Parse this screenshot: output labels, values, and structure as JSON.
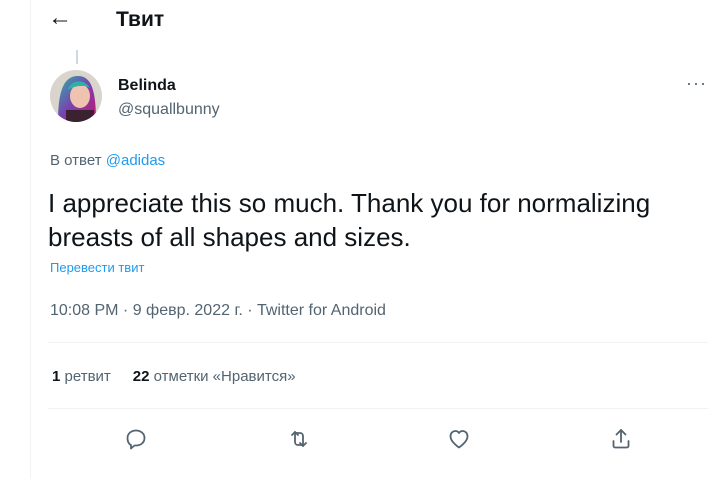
{
  "header": {
    "back_icon": "arrow-left-icon",
    "title": "Твит"
  },
  "tweet": {
    "author_name": "Belinda",
    "author_handle": "@squallbunny",
    "more_icon": "ellipsis-icon",
    "more_glyph": "···",
    "reply_prefix": "В ответ",
    "reply_to": "@adidas",
    "text": "I appreciate this so much. Thank you for normalizing breasts of all shapes and sizes.",
    "translate_label": "Перевести твит",
    "time": "10:08 PM",
    "date": "9 февр. 2022 г.",
    "source": "Twitter for Android",
    "separator": " · "
  },
  "stats": {
    "retweets_count": "1",
    "retweets_label": "ретвит",
    "likes_count": "22",
    "likes_label": "отметки «Нравится»"
  },
  "actions": [
    {
      "icon": "reply-icon"
    },
    {
      "icon": "retweet-icon"
    },
    {
      "icon": "like-icon"
    },
    {
      "icon": "share-icon"
    }
  ],
  "colors": {
    "accent": "#1d9bf0",
    "text": "#0f1419",
    "secondary": "#536471",
    "divider": "#eff3f4"
  }
}
